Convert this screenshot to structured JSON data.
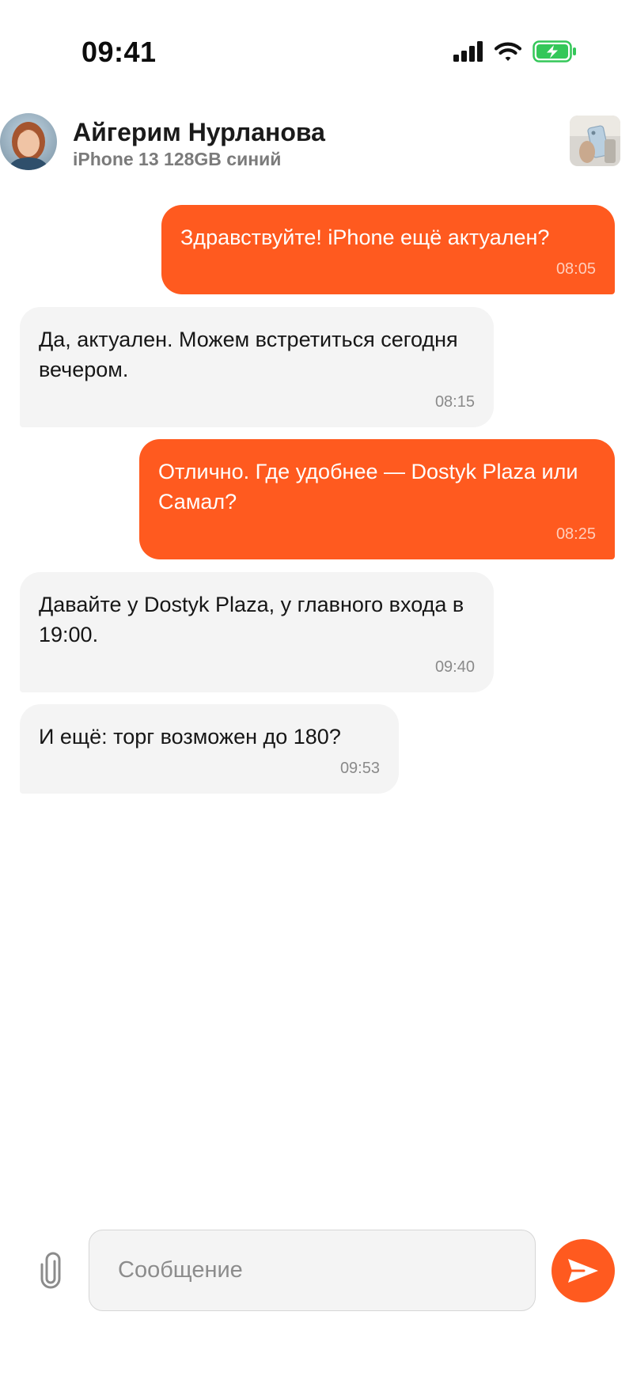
{
  "status_bar": {
    "time": "09:41",
    "icons": [
      "signal-icon",
      "wifi-icon",
      "battery-charging-icon"
    ],
    "battery_color": "#34c759"
  },
  "header": {
    "contact_name": "Айгерим Нурланова",
    "listing_title": "iPhone 13 128GB синий"
  },
  "messages": [
    {
      "direction": "outgoing",
      "text": "Здравствуйте! iPhone ещё актуален?",
      "time": "08:05"
    },
    {
      "direction": "incoming",
      "text": "Да, актуален. Можем встретиться сегодня вечером.",
      "time": "08:15"
    },
    {
      "direction": "outgoing",
      "text": "Отлично. Где удобнее — Dostyk Plaza или Самал?",
      "time": "08:25"
    },
    {
      "direction": "incoming",
      "text": "Давайте у Dostyk Plaza, у главного входа в 19:00.",
      "time": "09:40"
    },
    {
      "direction": "incoming",
      "text": "И ещё: торг возможен до 180?",
      "time": "09:53"
    }
  ],
  "composer": {
    "placeholder": "Сообщение",
    "value": "",
    "attach_icon": "paperclip-icon",
    "send_icon": "send-icon"
  },
  "colors": {
    "accent": "#ff5a1f",
    "incoming_bubble": "#f4f4f4",
    "background": "#ffffff"
  }
}
